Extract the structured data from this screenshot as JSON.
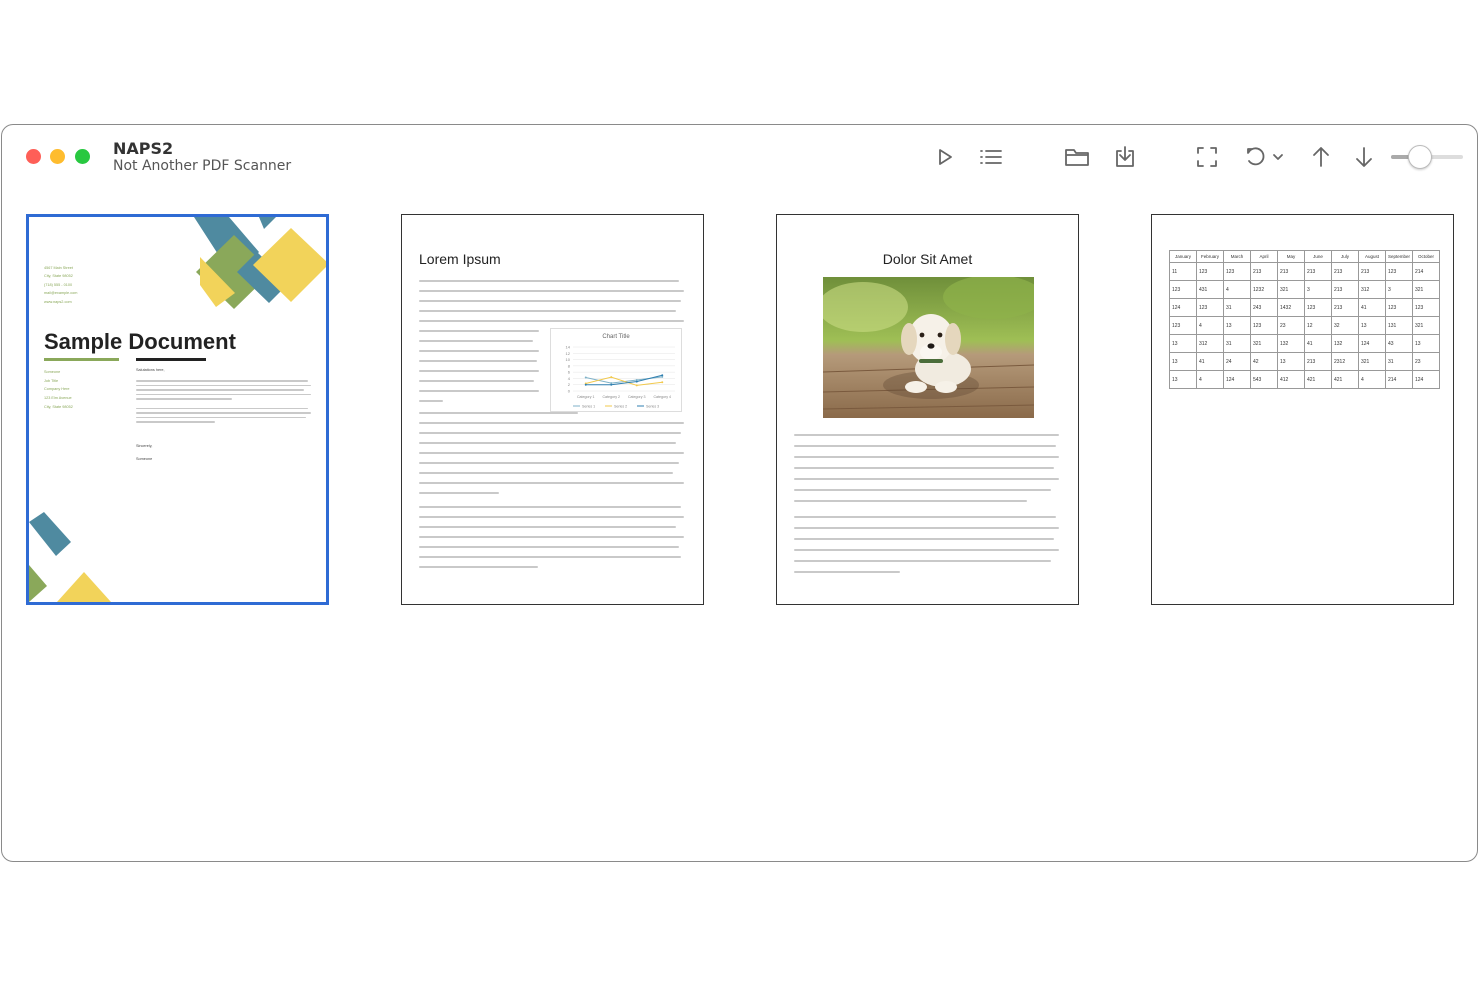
{
  "window": {
    "title": "NAPS2",
    "subtitle": "Not Another PDF Scanner"
  },
  "toolbar": {
    "icons": [
      "play-icon",
      "list-icon",
      "folder-icon",
      "save-icon",
      "crop-icon",
      "rotate-icon",
      "chevron-down-icon",
      "arrow-up-icon",
      "arrow-down-icon"
    ],
    "zoom_level": 0.4
  },
  "pages": [
    {
      "heading": "Sample Document",
      "address": [
        "4567 Main Street",
        "City, State 98052",
        "(718) 555 - 0100",
        "mail@example.com",
        "www.naps2.com"
      ],
      "sidebar": [
        "Someone",
        "Job Title",
        "Company Here",
        "123 Elm Avenue",
        "City, State 98052"
      ],
      "salutation": "Salutations here,",
      "closing": "Sincerely,",
      "signature": "Someone",
      "accent_colors": [
        "#4f8aa0",
        "#8aa85a",
        "#f2d35a",
        "#2f6bd4"
      ]
    },
    {
      "heading": "Lorem Ipsum",
      "chart_data": {
        "type": "line",
        "title": "Chart Title",
        "categories": [
          "Category 1",
          "Category 2",
          "Category 3",
          "Category 4"
        ],
        "ylim": [
          0,
          14
        ],
        "yticks": [
          "14",
          "12",
          "10",
          "8",
          "6",
          "4",
          "2",
          "0"
        ],
        "series": [
          {
            "name": "Series 1",
            "values": [
              4.3,
              2.5,
              3.5,
              4.5
            ],
            "color": "#7fb2c8"
          },
          {
            "name": "Series 2",
            "values": [
              2.4,
              4.4,
              1.8,
              2.8
            ],
            "color": "#f2c94c"
          },
          {
            "name": "Series 3",
            "values": [
              2,
              2,
              3,
              5
            ],
            "color": "#2f7fb0"
          }
        ]
      }
    },
    {
      "heading": "Dolor Sit Amet",
      "image": "puppy-photo"
    },
    {
      "heading": "",
      "table": [
        [
          "January",
          "February",
          "March",
          "April",
          "May",
          "June",
          "July",
          "August",
          "September",
          "October"
        ],
        [
          "11",
          "123",
          "123",
          "213",
          "213",
          "213",
          "213",
          "213",
          "123",
          "214"
        ],
        [
          "123",
          "431",
          "4",
          "1232",
          "321",
          "3",
          "213",
          "312",
          "3",
          "321"
        ],
        [
          "124",
          "123",
          "31",
          "243",
          "1432",
          "123",
          "213",
          "41",
          "123",
          "123"
        ],
        [
          "123",
          "4",
          "13",
          "123",
          "23",
          "12",
          "32",
          "13",
          "131",
          "321"
        ],
        [
          "13",
          "312",
          "31",
          "321",
          "132",
          "41",
          "132",
          "124",
          "43",
          "13"
        ],
        [
          "13",
          "41",
          "24",
          "42",
          "13",
          "213",
          "2312",
          "321",
          "31",
          "23"
        ],
        [
          "13",
          "4",
          "124",
          "543",
          "412",
          "421",
          "421",
          "4",
          "214",
          "124"
        ]
      ]
    }
  ]
}
